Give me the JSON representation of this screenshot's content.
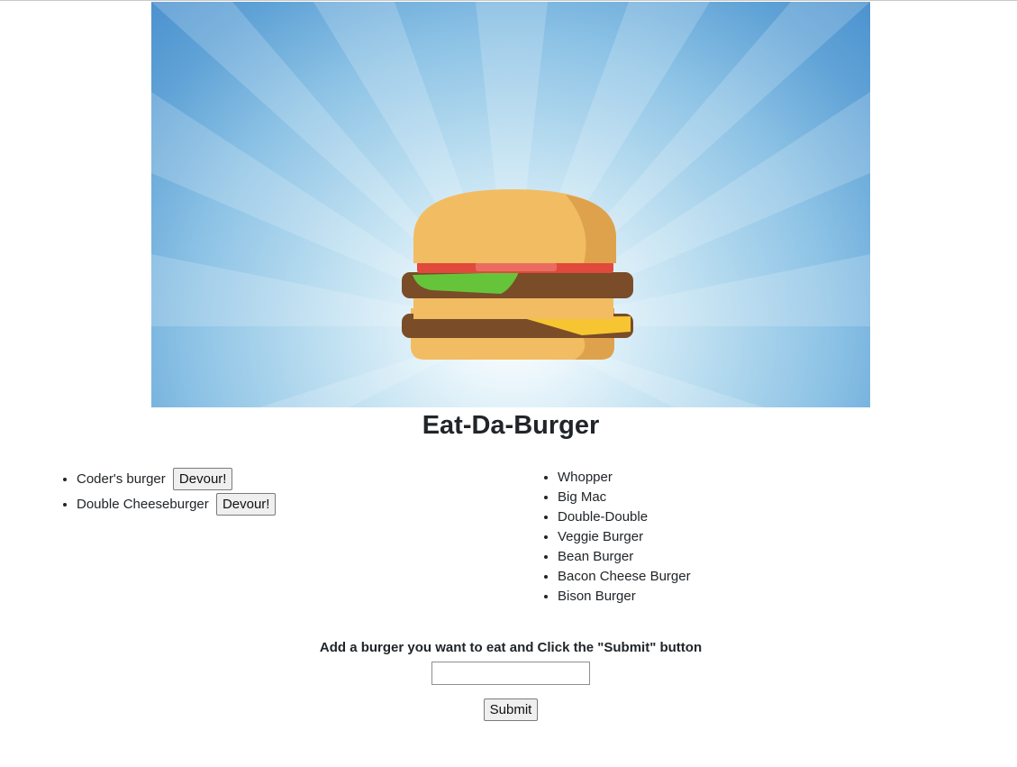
{
  "header": {
    "title": "Eat-Da-Burger"
  },
  "hero": {
    "image_icon": "burger-illustration",
    "colors": {
      "sky_outer": "#4c92cf",
      "sky_inner": "#ffffff",
      "bun": "#f2bc62",
      "patty": "#7a4c28",
      "lettuce": "#66c43b",
      "tomato": "#e0493c",
      "cheese": "#f6c531"
    }
  },
  "devoured_list": {
    "items": [
      {
        "name": "Coder's burger",
        "button_label": "Devour!"
      },
      {
        "name": "Double Cheeseburger",
        "button_label": "Devour!"
      }
    ]
  },
  "menu_list": {
    "items": [
      "Whopper",
      "Big Mac",
      "Double-Double",
      "Veggie Burger",
      "Bean Burger",
      "Bacon Cheese Burger",
      "Bison Burger"
    ]
  },
  "form": {
    "label": "Add a burger you want to eat and Click the \"Submit\" button",
    "input_value": "",
    "submit_label": "Submit"
  }
}
